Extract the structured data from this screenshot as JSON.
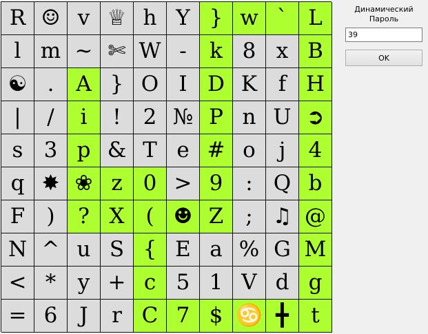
{
  "panel": {
    "title_line1": "Динамический",
    "title_line2": "Пароль",
    "password_value": "39",
    "ok_label": "OK"
  },
  "grid": {
    "rows": [
      [
        {
          "text": "R",
          "bg": "grey",
          "name": "letter-r"
        },
        {
          "text": "☺",
          "bg": "grey",
          "name": "smiley-icon"
        },
        {
          "text": "v",
          "bg": "grey",
          "name": "letter-v"
        },
        {
          "text": "♕",
          "bg": "grey",
          "name": "crown-icon"
        },
        {
          "text": "h",
          "bg": "grey",
          "name": "letter-h"
        },
        {
          "text": "Y",
          "bg": "grey",
          "name": "letter-y"
        },
        {
          "text": "}",
          "bg": "green",
          "name": "right-brace"
        },
        {
          "text": "w",
          "bg": "green",
          "name": "letter-w"
        },
        {
          "text": "`",
          "bg": "green",
          "name": "backtick"
        },
        {
          "text": "L",
          "bg": "green",
          "name": "letter-l"
        }
      ],
      [
        {
          "text": "l",
          "bg": "grey",
          "name": "letter-l-lower"
        },
        {
          "text": "m",
          "bg": "grey",
          "name": "letter-m"
        },
        {
          "text": "~",
          "bg": "grey",
          "name": "tilde"
        },
        {
          "text": "✄",
          "bg": "grey",
          "name": "scissors-icon"
        },
        {
          "text": "W",
          "bg": "grey",
          "name": "letter-w-upper"
        },
        {
          "text": "-",
          "bg": "grey",
          "name": "hyphen"
        },
        {
          "text": "k",
          "bg": "green",
          "name": "letter-k"
        },
        {
          "text": "8",
          "bg": "grey",
          "name": "digit-8"
        },
        {
          "text": "x",
          "bg": "grey",
          "name": "letter-x"
        },
        {
          "text": "B",
          "bg": "green",
          "name": "letter-b"
        }
      ],
      [
        {
          "text": "☯",
          "bg": "grey",
          "name": "yin-yang-icon"
        },
        {
          "text": ".",
          "bg": "grey",
          "name": "period"
        },
        {
          "text": "A",
          "bg": "green",
          "name": "letter-a"
        },
        {
          "text": "}",
          "bg": "grey",
          "name": "right-brace-2"
        },
        {
          "text": "O",
          "bg": "grey",
          "name": "letter-o"
        },
        {
          "text": "I",
          "bg": "grey",
          "name": "letter-i"
        },
        {
          "text": "D",
          "bg": "green",
          "name": "letter-d"
        },
        {
          "text": "K",
          "bg": "grey",
          "name": "letter-k-upper"
        },
        {
          "text": "f",
          "bg": "grey",
          "name": "letter-f"
        },
        {
          "text": "H",
          "bg": "green",
          "name": "letter-h-upper"
        }
      ],
      [
        {
          "text": "|",
          "bg": "grey",
          "name": "pipe"
        },
        {
          "text": "/",
          "bg": "grey",
          "name": "slash"
        },
        {
          "text": "i",
          "bg": "green",
          "name": "letter-i-lower"
        },
        {
          "text": "!",
          "bg": "grey",
          "name": "exclamation"
        },
        {
          "text": "2",
          "bg": "grey",
          "name": "digit-2"
        },
        {
          "text": "№",
          "bg": "grey",
          "name": "numero-sign"
        },
        {
          "text": "P",
          "bg": "green",
          "name": "letter-p"
        },
        {
          "text": "n",
          "bg": "grey",
          "name": "letter-n"
        },
        {
          "text": "U",
          "bg": "grey",
          "name": "letter-u"
        },
        {
          "text": "➲",
          "bg": "green",
          "name": "arrow-circle-icon"
        }
      ],
      [
        {
          "text": "s",
          "bg": "grey",
          "name": "letter-s"
        },
        {
          "text": "3",
          "bg": "grey",
          "name": "digit-3"
        },
        {
          "text": "p",
          "bg": "green",
          "name": "letter-p-lower"
        },
        {
          "text": "&",
          "bg": "grey",
          "name": "ampersand"
        },
        {
          "text": "T",
          "bg": "grey",
          "name": "letter-t"
        },
        {
          "text": "e",
          "bg": "grey",
          "name": "letter-e"
        },
        {
          "text": "#",
          "bg": "green",
          "name": "hash"
        },
        {
          "text": "o",
          "bg": "grey",
          "name": "letter-o-lower"
        },
        {
          "text": "j",
          "bg": "grey",
          "name": "letter-j"
        },
        {
          "text": "4",
          "bg": "green",
          "name": "digit-4"
        }
      ],
      [
        {
          "text": "q",
          "bg": "grey",
          "name": "letter-q"
        },
        {
          "text": "✸",
          "bg": "grey",
          "name": "star-burst-icon"
        },
        {
          "text": "❀",
          "bg": "green",
          "name": "flower-icon"
        },
        {
          "text": "z",
          "bg": "green",
          "name": "letter-z"
        },
        {
          "text": "0",
          "bg": "green",
          "name": "digit-0"
        },
        {
          "text": ">",
          "bg": "grey",
          "name": "greater-than"
        },
        {
          "text": "9",
          "bg": "green",
          "name": "digit-9"
        },
        {
          "text": ":",
          "bg": "grey",
          "name": "colon"
        },
        {
          "text": "Q",
          "bg": "grey",
          "name": "letter-q-upper"
        },
        {
          "text": "b",
          "bg": "green",
          "name": "letter-b-lower"
        }
      ],
      [
        {
          "text": "F",
          "bg": "grey",
          "name": "letter-f-upper"
        },
        {
          "text": ")",
          "bg": "grey",
          "name": "right-paren"
        },
        {
          "text": "?",
          "bg": "green",
          "name": "question-mark"
        },
        {
          "text": "X",
          "bg": "green",
          "name": "letter-x-upper"
        },
        {
          "text": "(",
          "bg": "green",
          "name": "left-paren"
        },
        {
          "text": "☻",
          "bg": "green",
          "name": "black-smiley-icon"
        },
        {
          "text": "Z",
          "bg": "green",
          "name": "letter-z-upper"
        },
        {
          "text": ";",
          "bg": "grey",
          "name": "semicolon"
        },
        {
          "text": "♫",
          "bg": "grey",
          "name": "music-note-icon"
        },
        {
          "text": "@",
          "bg": "green",
          "name": "at-sign"
        }
      ],
      [
        {
          "text": "N",
          "bg": "grey",
          "name": "letter-n-upper"
        },
        {
          "text": "^",
          "bg": "grey",
          "name": "caret"
        },
        {
          "text": "u",
          "bg": "grey",
          "name": "letter-u-lower"
        },
        {
          "text": "S",
          "bg": "grey",
          "name": "letter-s-upper"
        },
        {
          "text": "{",
          "bg": "green",
          "name": "left-brace"
        },
        {
          "text": "E",
          "bg": "grey",
          "name": "letter-e-upper"
        },
        {
          "text": "a",
          "bg": "grey",
          "name": "letter-a-lower"
        },
        {
          "text": "%",
          "bg": "grey",
          "name": "percent"
        },
        {
          "text": "G",
          "bg": "grey",
          "name": "letter-g"
        },
        {
          "text": "M",
          "bg": "green",
          "name": "letter-m-upper"
        }
      ],
      [
        {
          "text": "<",
          "bg": "grey",
          "name": "less-than"
        },
        {
          "text": "*",
          "bg": "grey",
          "name": "asterisk"
        },
        {
          "text": "y",
          "bg": "grey",
          "name": "letter-y-lower"
        },
        {
          "text": "+",
          "bg": "grey",
          "name": "plus"
        },
        {
          "text": "c",
          "bg": "green",
          "name": "letter-c"
        },
        {
          "text": "5",
          "bg": "grey",
          "name": "digit-5"
        },
        {
          "text": "1",
          "bg": "grey",
          "name": "digit-1"
        },
        {
          "text": "V",
          "bg": "grey",
          "name": "letter-v-upper"
        },
        {
          "text": "d",
          "bg": "grey",
          "name": "letter-d-lower"
        },
        {
          "text": "g",
          "bg": "green",
          "name": "letter-g-lower"
        }
      ],
      [
        {
          "text": "=",
          "bg": "grey",
          "name": "equals"
        },
        {
          "text": "6",
          "bg": "grey",
          "name": "digit-6"
        },
        {
          "text": "J",
          "bg": "grey",
          "name": "letter-j-upper"
        },
        {
          "text": "r",
          "bg": "grey",
          "name": "letter-r-lower"
        },
        {
          "text": "C",
          "bg": "green",
          "name": "letter-c-upper"
        },
        {
          "text": "7",
          "bg": "green",
          "name": "digit-7"
        },
        {
          "text": "$",
          "bg": "green",
          "name": "dollar"
        },
        {
          "text": "♋",
          "bg": "green",
          "name": "cancer-sign-icon"
        },
        {
          "text": "╋",
          "bg": "green",
          "name": "cross-icon"
        },
        {
          "text": "t",
          "bg": "green",
          "name": "letter-t-lower"
        }
      ]
    ]
  }
}
